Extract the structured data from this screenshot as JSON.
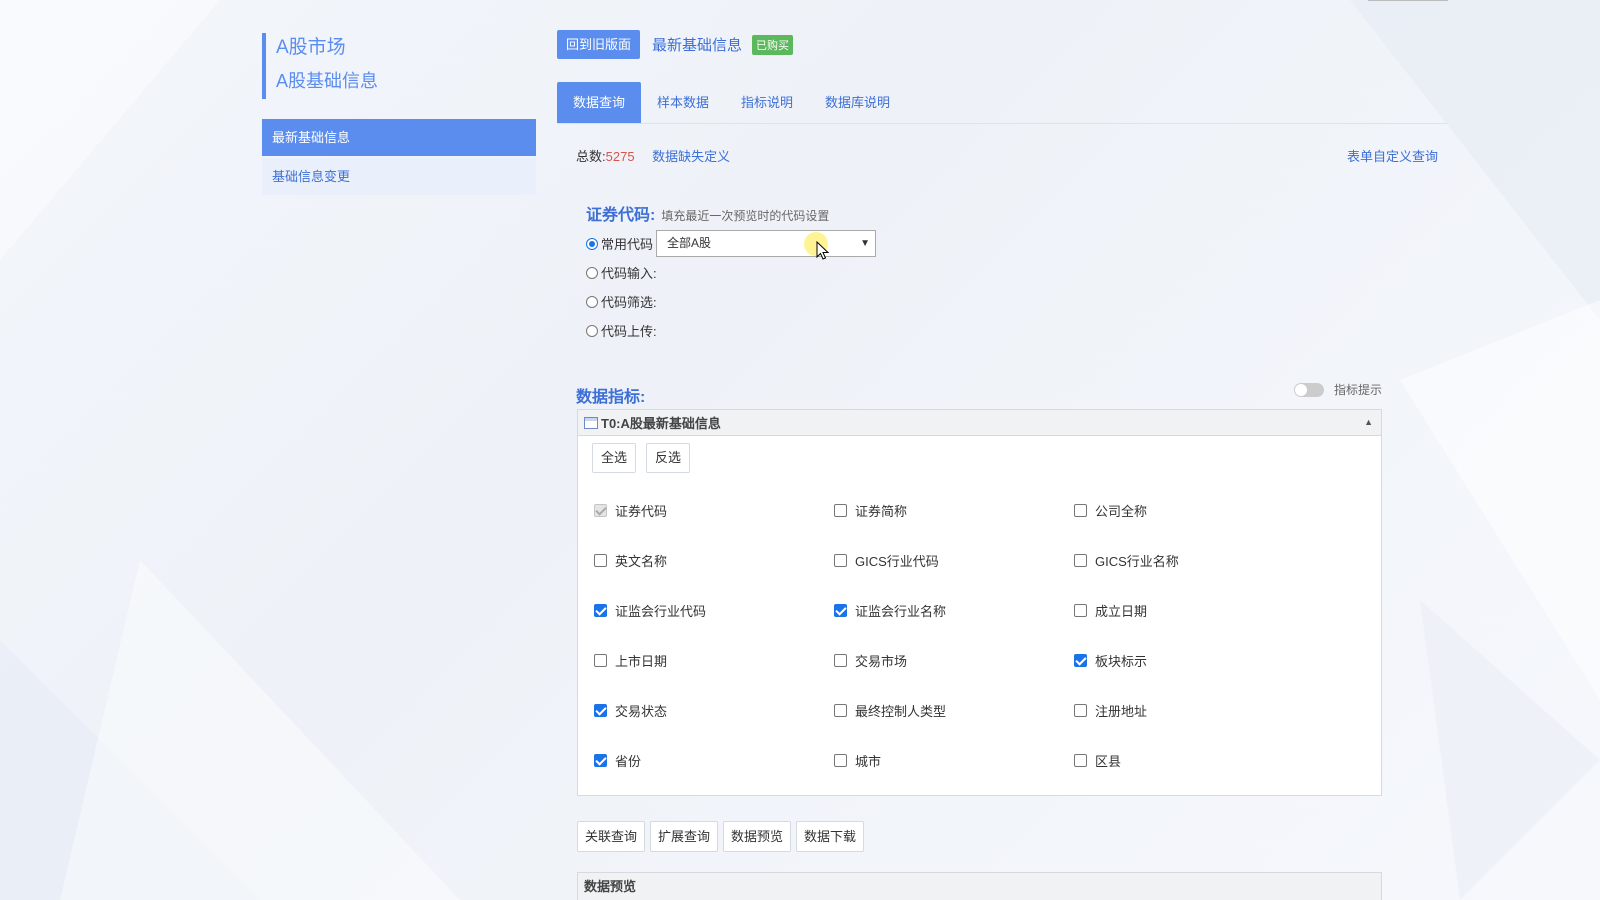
{
  "sidebar": {
    "title_line1": "A股市场",
    "title_line2": "A股基础信息",
    "items": [
      {
        "label": "最新基础信息",
        "active": true
      },
      {
        "label": "基础信息变更",
        "active": false
      }
    ]
  },
  "header": {
    "back_button": "回到旧版面",
    "title": "最新基础信息",
    "badge": "已购买"
  },
  "tabs": [
    {
      "label": "数据查询",
      "active": true
    },
    {
      "label": "样本数据",
      "active": false
    },
    {
      "label": "指标说明",
      "active": false
    },
    {
      "label": "数据库说明",
      "active": false
    }
  ],
  "stats": {
    "total_label": "总数:",
    "total_value": "5275",
    "missing_def_link": "数据缺失定义",
    "custom_query_link": "表单自定义查询"
  },
  "code_section": {
    "title": "证券代码:",
    "hint": "填充最近一次预览时的代码设置",
    "options": [
      {
        "label": "常用代码",
        "selected": true
      },
      {
        "label": "代码输入:",
        "selected": false
      },
      {
        "label": "代码筛选:",
        "selected": false
      },
      {
        "label": "代码上传:",
        "selected": false
      }
    ],
    "select_value": "全部A股"
  },
  "indicators": {
    "title": "数据指标:",
    "toggle_label": "指标提示",
    "toggle_on": false,
    "panel_title": "T0:A股最新基础信息",
    "select_all": "全选",
    "invert": "反选",
    "fields": [
      {
        "label": "证券代码",
        "checked": true,
        "disabled": true
      },
      {
        "label": "证券简称",
        "checked": false
      },
      {
        "label": "公司全称",
        "checked": false
      },
      {
        "label": "英文名称",
        "checked": false
      },
      {
        "label": "GICS行业代码",
        "checked": false
      },
      {
        "label": "GICS行业名称",
        "checked": false
      },
      {
        "label": "证监会行业代码",
        "checked": true
      },
      {
        "label": "证监会行业名称",
        "checked": true
      },
      {
        "label": "成立日期",
        "checked": false
      },
      {
        "label": "上市日期",
        "checked": false
      },
      {
        "label": "交易市场",
        "checked": false
      },
      {
        "label": "板块标示",
        "checked": true
      },
      {
        "label": "交易状态",
        "checked": true
      },
      {
        "label": "最终控制人类型",
        "checked": false
      },
      {
        "label": "注册地址",
        "checked": false
      },
      {
        "label": "省份",
        "checked": true
      },
      {
        "label": "城市",
        "checked": false
      },
      {
        "label": "区县",
        "checked": false
      }
    ]
  },
  "actions": [
    "关联查询",
    "扩展查询",
    "数据预览",
    "数据下载"
  ],
  "preview_title": "数据预览",
  "colors": {
    "accent": "#5b8def",
    "link": "#3d6fd6",
    "badge": "#5cb85c",
    "count": "#d9534f"
  }
}
